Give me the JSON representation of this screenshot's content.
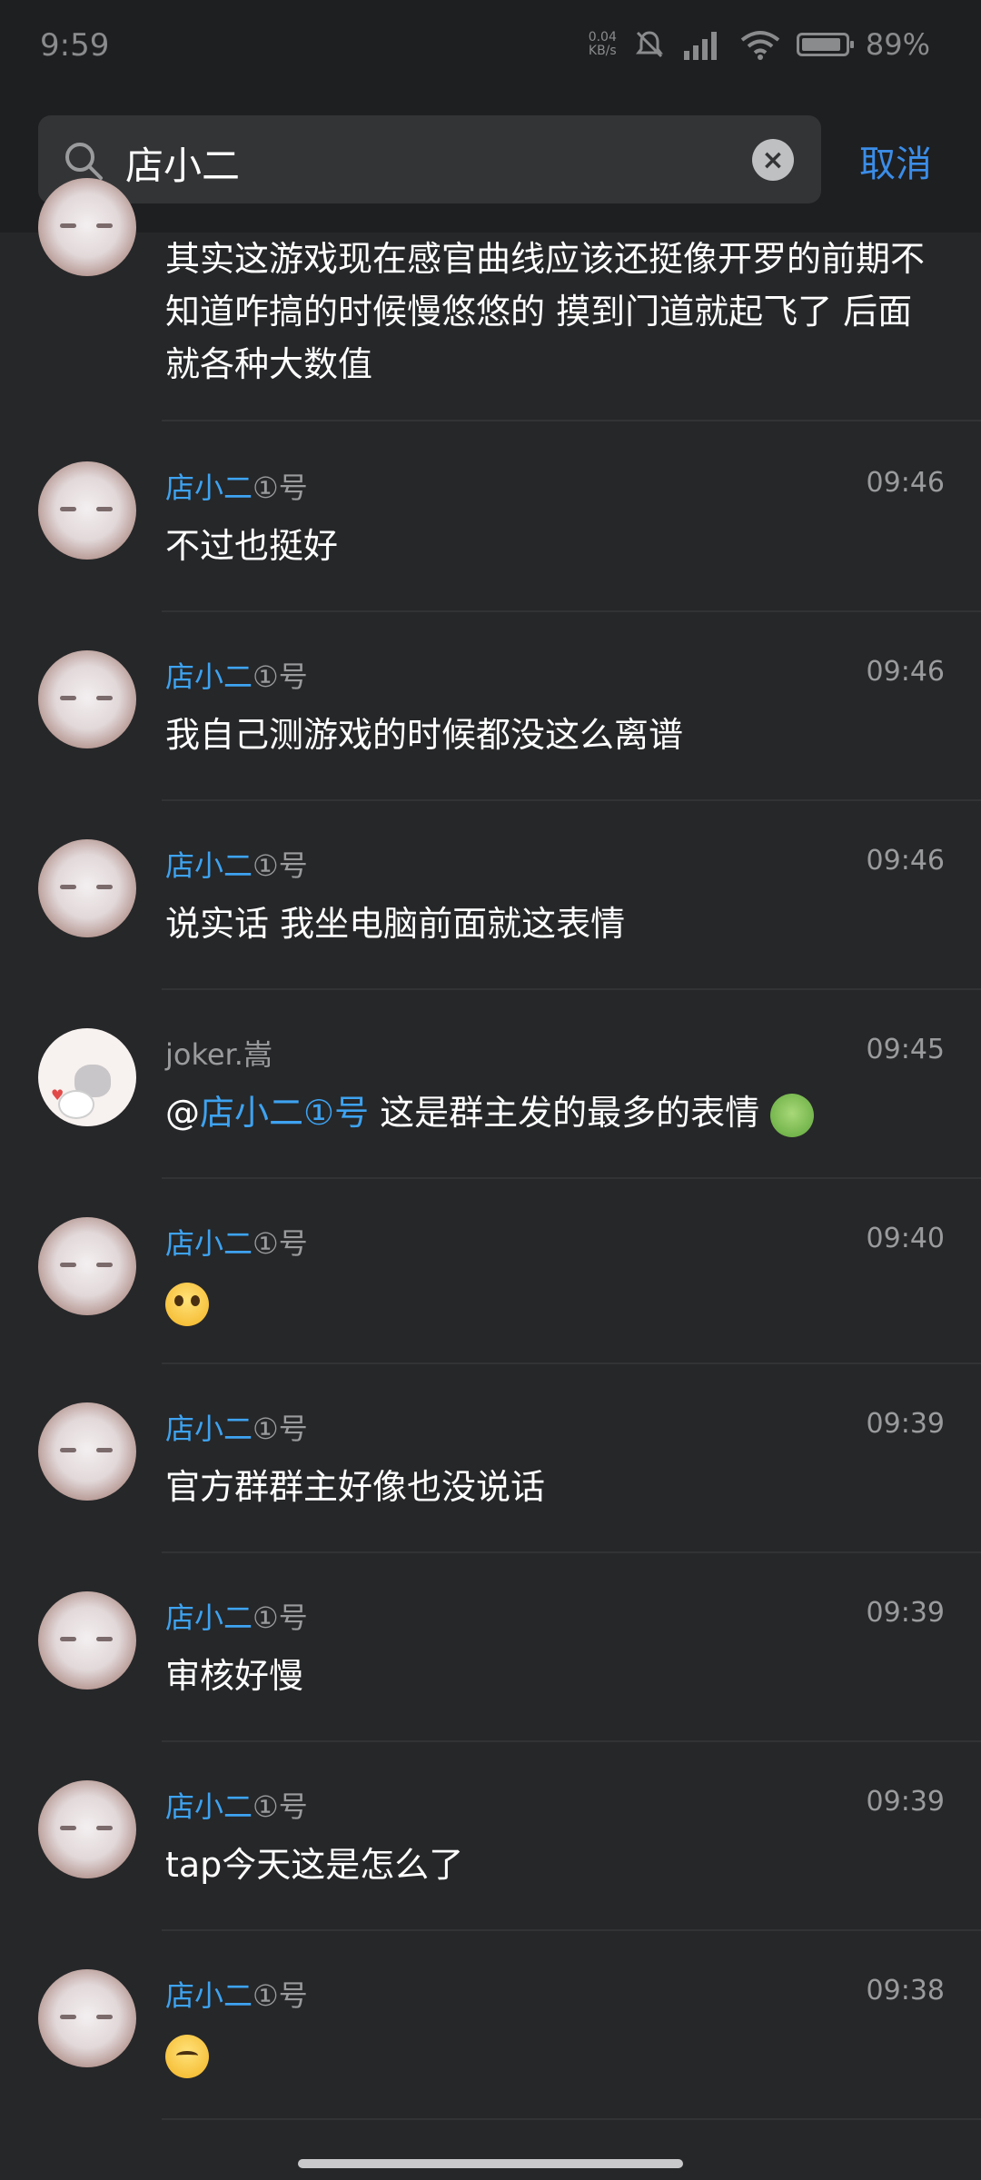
{
  "status_bar": {
    "time": "9:59",
    "net_speed_top": "0.04",
    "net_speed_bottom": "KB/s",
    "battery": "89%"
  },
  "search": {
    "query": "店小二",
    "clear_icon": "close-icon",
    "cancel_label": "取消"
  },
  "messages": [
    {
      "id": "m0",
      "sender": "",
      "suffix": "",
      "time": "",
      "text": "其实这游戏现在感官曲线应该还挺像开罗的前期不知道咋搞的时候慢悠悠的 摸到门道就起飞了 后面就各种大数值",
      "avatar": "cat"
    },
    {
      "id": "m1",
      "sender": "店小二",
      "suffix": "①号",
      "time": "09:46",
      "text": "不过也挺好",
      "avatar": "cat"
    },
    {
      "id": "m2",
      "sender": "店小二",
      "suffix": "①号",
      "time": "09:46",
      "text": "我自己测游戏的时候都没这么离谱",
      "avatar": "cat"
    },
    {
      "id": "m3",
      "sender": "店小二",
      "suffix": "①号",
      "time": "09:46",
      "text": "说实话 我坐电脑前面就这表情",
      "avatar": "cat"
    },
    {
      "id": "m4",
      "sender": "joker.嵩",
      "suffix": "",
      "time": "09:45",
      "text_prefix": "@",
      "mention": "店小二①号",
      "text": " 这是群主发的最多的表情",
      "avatar": "joker"
    },
    {
      "id": "m5",
      "sender": "店小二",
      "suffix": "①号",
      "time": "09:40",
      "text": "",
      "emoji": "shocked-face",
      "avatar": "cat"
    },
    {
      "id": "m6",
      "sender": "店小二",
      "suffix": "①号",
      "time": "09:39",
      "text": "官方群群主好像也没说话",
      "avatar": "cat"
    },
    {
      "id": "m7",
      "sender": "店小二",
      "suffix": "①号",
      "time": "09:39",
      "text": "审核好慢",
      "avatar": "cat"
    },
    {
      "id": "m8",
      "sender": "店小二",
      "suffix": "①号",
      "time": "09:39",
      "text": "tap今天这是怎么了",
      "avatar": "cat"
    },
    {
      "id": "m9",
      "sender": "店小二",
      "suffix": "①号",
      "time": "09:38",
      "text": "",
      "emoji": "sad-face",
      "avatar": "cat"
    }
  ]
}
